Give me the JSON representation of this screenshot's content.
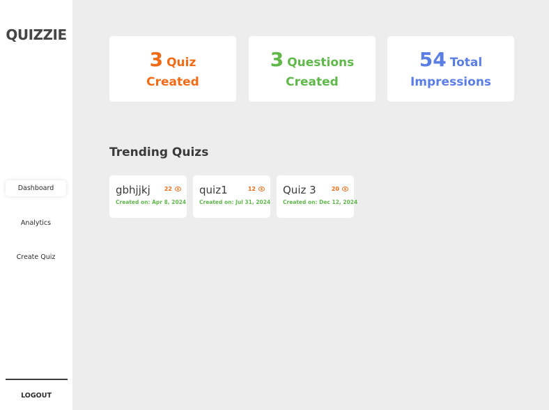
{
  "app": {
    "logo": "QUIZZIE"
  },
  "sidebar": {
    "items": [
      {
        "label": "Dashboard",
        "active": true
      },
      {
        "label": "Analytics",
        "active": false
      },
      {
        "label": "Create Quiz",
        "active": false
      }
    ],
    "logout": "LOGOUT"
  },
  "stats": [
    {
      "number": "3",
      "word": "Quiz",
      "line2": "Created",
      "color": "#f26b16"
    },
    {
      "number": "3",
      "word": "Questions",
      "line2": "Created",
      "color": "#60b84b"
    },
    {
      "number": "54",
      "word": "Total",
      "line2": "Impressions",
      "color": "#5b7ee5"
    }
  ],
  "trending": {
    "title": "Trending Quizs",
    "quizzes": [
      {
        "name": "gbhjjkj",
        "views": "22",
        "date": "Created on: Apr 8, 2024",
        "icon": "eye-icon"
      },
      {
        "name": "quiz1",
        "views": "12",
        "date": "Created on: Jul 31, 2024",
        "icon": "eye-icon"
      },
      {
        "name": "Quiz 3",
        "views": "20",
        "date": "Created on: Dec 12, 2024",
        "icon": "eye-icon"
      }
    ]
  }
}
